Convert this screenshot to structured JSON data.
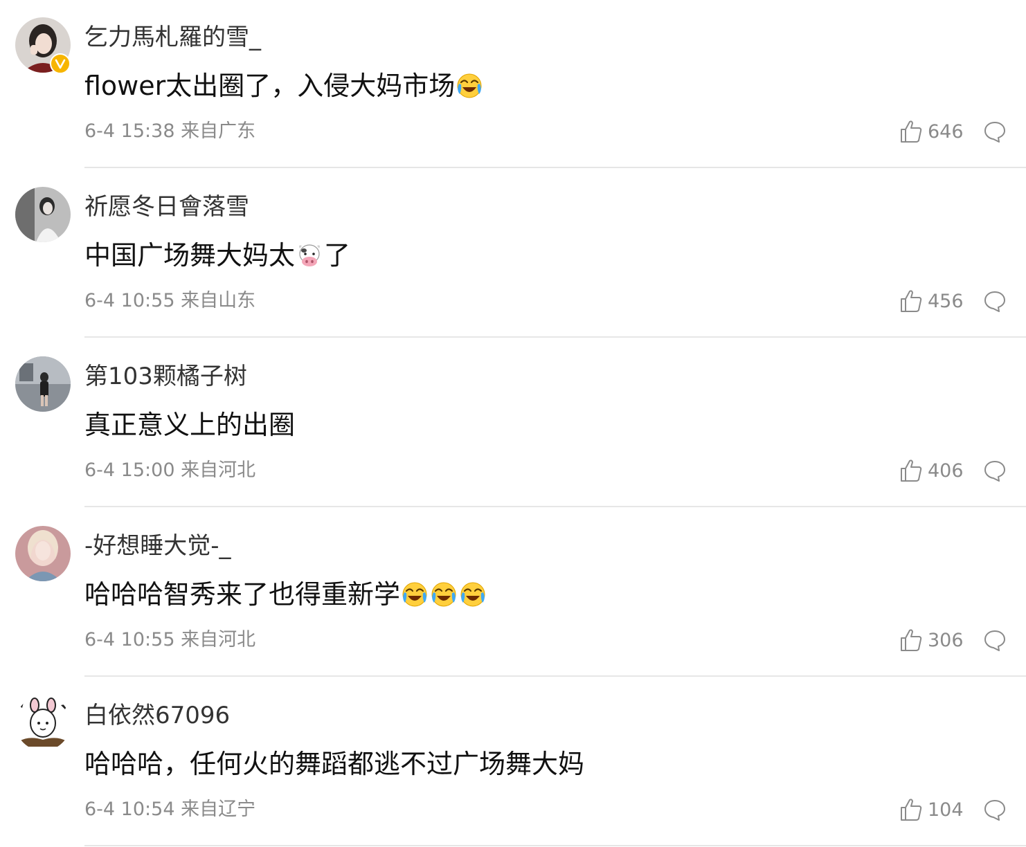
{
  "comments": [
    {
      "username": "乞力馬札羅的雪_",
      "verified": true,
      "text_parts": [
        "flower太出圈了，入侵大妈市场"
      ],
      "emojis": [
        "laugh-cry-emoji"
      ],
      "meta": "6-4 15:38 来自广东",
      "likes": "646"
    },
    {
      "username": "祈愿冬日會落雪",
      "verified": false,
      "text_parts": [
        "中国广场舞大妈太",
        "了"
      ],
      "emojis": [
        "cow-emoji"
      ],
      "meta": "6-4 10:55 来自山东",
      "likes": "456"
    },
    {
      "username": "第103颗橘子树",
      "verified": false,
      "text_parts": [
        "真正意义上的出圈"
      ],
      "emojis": [],
      "meta": "6-4 15:00 来自河北",
      "likes": "406"
    },
    {
      "username": "-好想睡大觉-_",
      "verified": false,
      "text_parts": [
        "哈哈哈智秀来了也得重新学"
      ],
      "emojis": [
        "laugh-cry-emoji",
        "laugh-cry-emoji",
        "laugh-cry-emoji"
      ],
      "meta": "6-4 10:55 来自河北",
      "likes": "306"
    },
    {
      "username": "白依然67096",
      "verified": false,
      "text_parts": [
        "哈哈哈，任何火的舞蹈都逃不过广场舞大妈"
      ],
      "emojis": [],
      "meta": "6-4 10:54 来自辽宁",
      "likes": "104"
    }
  ],
  "colors": {
    "meta_gray": "#8a8a8a",
    "divider": "#e6e6e6",
    "verified_badge": "#f7b500"
  }
}
